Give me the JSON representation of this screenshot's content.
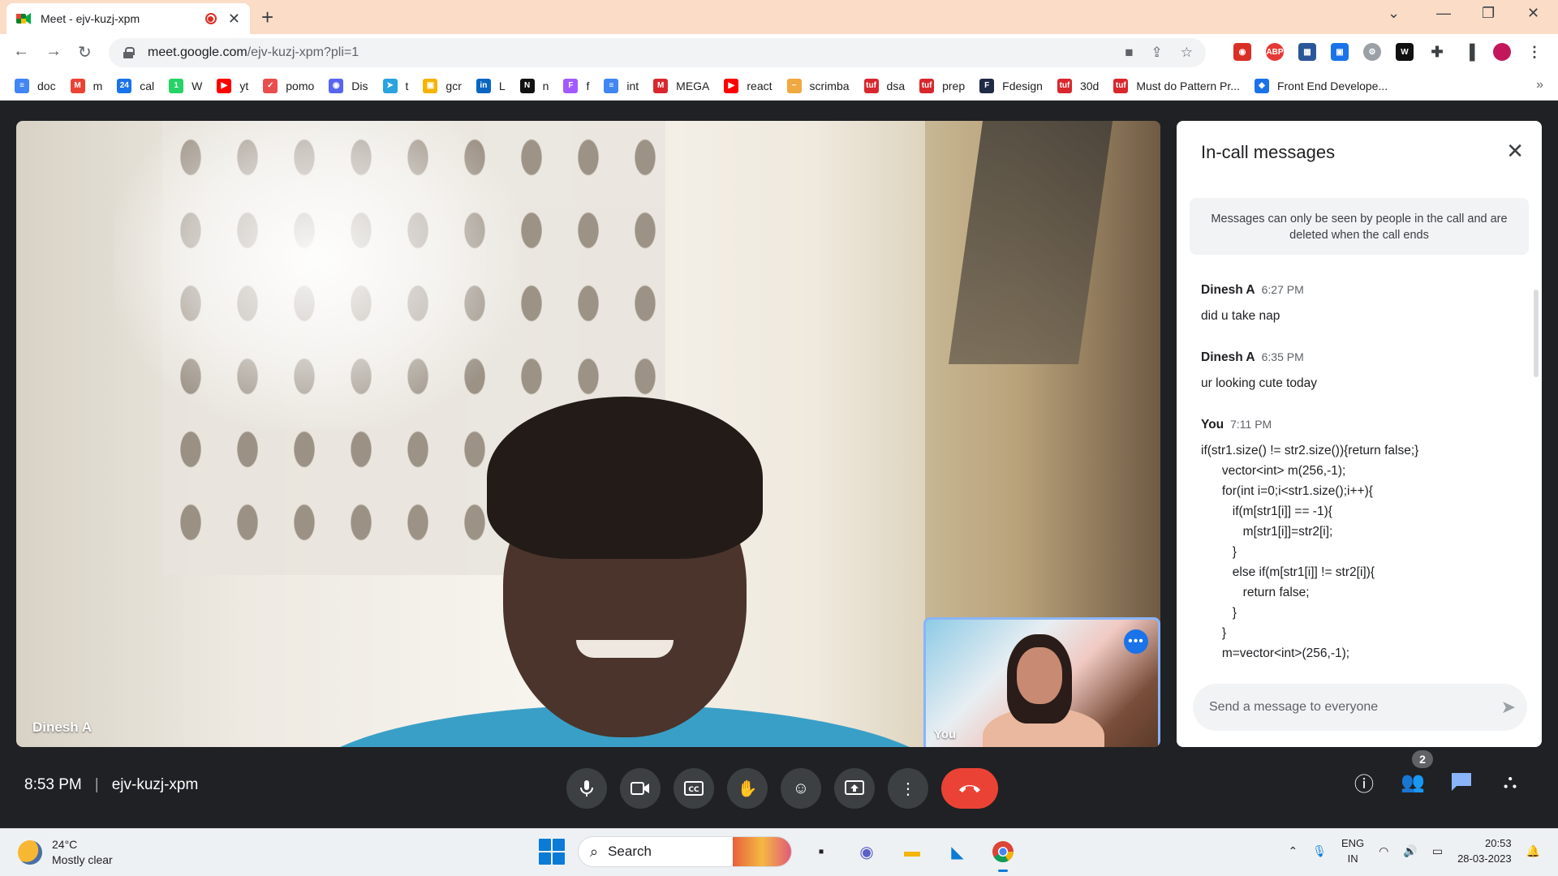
{
  "browser": {
    "tab_title": "Meet - ejv-kuzj-xpm",
    "url_host": "meet.google.com",
    "url_path": "/ejv-kuzj-xpm?pli=1",
    "new_tab": "+",
    "more_bookmarks": "»"
  },
  "bookmarks": [
    {
      "label": "doc",
      "icon": "docs-icon",
      "color": "#4285f4",
      "glyph": "≡"
    },
    {
      "label": "m",
      "icon": "gmail-icon",
      "color": "#ea4335",
      "glyph": "M"
    },
    {
      "label": "cal",
      "icon": "calendar-icon",
      "color": "#1a73e8",
      "glyph": "24"
    },
    {
      "label": "W",
      "icon": "whatsapp-icon",
      "color": "#25d366",
      "glyph": "1"
    },
    {
      "label": "yt",
      "icon": "youtube-icon",
      "color": "#ff0000",
      "glyph": "▶"
    },
    {
      "label": "pomo",
      "icon": "pomodoro-icon",
      "color": "#e94e4e",
      "glyph": "✓"
    },
    {
      "label": "Dis",
      "icon": "discord-icon",
      "color": "#5865f2",
      "glyph": "◉"
    },
    {
      "label": "t",
      "icon": "telegram-icon",
      "color": "#2aa3df",
      "glyph": "➤"
    },
    {
      "label": "gcr",
      "icon": "classroom-icon",
      "color": "#f4b400",
      "glyph": "▣"
    },
    {
      "label": "L",
      "icon": "linkedin-icon",
      "color": "#0a66c2",
      "glyph": "in"
    },
    {
      "label": "n",
      "icon": "notion-icon",
      "color": "#111111",
      "glyph": "N"
    },
    {
      "label": "f",
      "icon": "figma-icon",
      "color": "#a259ff",
      "glyph": "F"
    },
    {
      "label": "int",
      "icon": "docs-icon",
      "color": "#4285f4",
      "glyph": "≡"
    },
    {
      "label": "MEGA",
      "icon": "mega-icon",
      "color": "#d9272e",
      "glyph": "M"
    },
    {
      "label": "react",
      "icon": "youtube-icon",
      "color": "#ff0000",
      "glyph": "▶"
    },
    {
      "label": "scrimba",
      "icon": "scrimba-icon",
      "color": "#f0a840",
      "glyph": "~"
    },
    {
      "label": "dsa",
      "icon": "tuf-icon",
      "color": "#d9272e",
      "glyph": "tuf"
    },
    {
      "label": "prep",
      "icon": "tuf-icon",
      "color": "#d9272e",
      "glyph": "tuf"
    },
    {
      "label": "Fdesign",
      "icon": "fdesign-icon",
      "color": "#1f2a44",
      "glyph": "F"
    },
    {
      "label": "30d",
      "icon": "tuf-icon",
      "color": "#d9272e",
      "glyph": "tuf"
    },
    {
      "label": "Must do Pattern Pr...",
      "icon": "tuf-icon",
      "color": "#d9272e",
      "glyph": "tuf"
    },
    {
      "label": "Front End Develope...",
      "icon": "frontend-icon",
      "color": "#1a73e8",
      "glyph": "◆"
    }
  ],
  "meet": {
    "main_participant": "Dinesh A",
    "self_label": "You",
    "time": "8:53 PM",
    "meeting_code": "ejv-kuzj-xpm",
    "participant_count": "2"
  },
  "chat": {
    "title": "In-call messages",
    "notice": "Messages can only be seen by people in the call and are deleted when the call ends",
    "placeholder": "Send a message to everyone",
    "messages": [
      {
        "sender": "Dinesh A",
        "time": "6:27 PM",
        "text": "did u take nap"
      },
      {
        "sender": "Dinesh A",
        "time": "6:35 PM",
        "text": "ur looking cute today"
      },
      {
        "sender": "You",
        "time": "7:11 PM",
        "text": "if(str1.size() != str2.size()){return false;}\n      vector<int> m(256,-1);\n      for(int i=0;i<str1.size();i++){\n         if(m[str1[i]] == -1){\n            m[str1[i]]=str2[i];\n         }\n         else if(m[str1[i]] != str2[i]){\n            return false;\n         }\n      }\n      m=vector<int>(256,-1);"
      }
    ]
  },
  "taskbar": {
    "temperature": "24°C",
    "weather": "Mostly clear",
    "search": "Search",
    "lang_1": "ENG",
    "lang_2": "IN",
    "clock_time": "20:53",
    "clock_date": "28-03-2023"
  },
  "colors": {
    "end_call": "#ea4335",
    "accent": "#1a73e8",
    "tabbar": "#fbdcc7"
  }
}
